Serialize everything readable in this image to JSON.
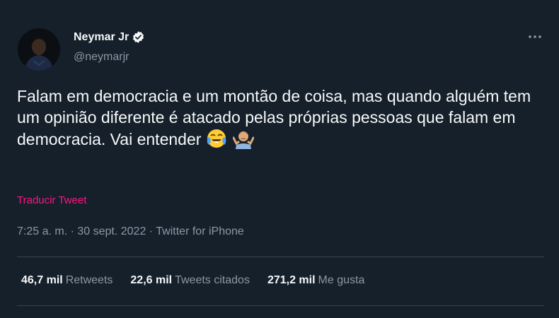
{
  "author": {
    "name": "Neymar Jr",
    "handle": "@neymarjr",
    "verified_icon": "verified-badge-icon"
  },
  "tweet": {
    "text": "Falam em democracia e um montão de coisa, mas quando alguém tem um opinião diferente é atacado pelas próprias pessoas que falam em democracia. Vai entender",
    "emojis": [
      "face-with-tears-of-joy",
      "person-shrugging"
    ],
    "translate_label": "Traducir Tweet"
  },
  "meta": {
    "time": "7:25 a. m.",
    "separator": " · ",
    "date": "30 sept. 2022",
    "source": "Twitter for iPhone"
  },
  "stats": {
    "retweets_count": "46,7 mil",
    "retweets_label": "Retweets",
    "quotes_count": "22,6 mil",
    "quotes_label": "Tweets citados",
    "likes_count": "271,2 mil",
    "likes_label": "Me gusta"
  },
  "colors": {
    "background": "#15202b",
    "text": "#f7f9f9",
    "secondary": "#8b98a5",
    "accent_pink": "#f91880",
    "divider": "#38444d"
  }
}
